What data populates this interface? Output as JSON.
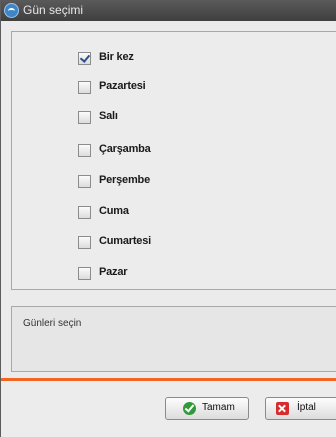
{
  "window": {
    "title": "Gün seçimi"
  },
  "days": [
    {
      "label": "Bir kez",
      "checked": true
    },
    {
      "label": "Pazartesi",
      "checked": false
    },
    {
      "label": "Salı",
      "checked": false
    },
    {
      "label": "Çarşamba",
      "checked": false
    },
    {
      "label": "Perşembe",
      "checked": false
    },
    {
      "label": "Cuma",
      "checked": false
    },
    {
      "label": "Cumartesi",
      "checked": false
    },
    {
      "label": "Pazar",
      "checked": false
    }
  ],
  "info": {
    "text": "Günleri seçin"
  },
  "buttons": {
    "ok_label": "Tamam",
    "cancel_label": "İptal"
  },
  "colors": {
    "accent": "#f26522",
    "titlebar": "#4a4a4a",
    "ok_icon": "#2f9a37",
    "cancel_icon": "#d82b2b"
  }
}
